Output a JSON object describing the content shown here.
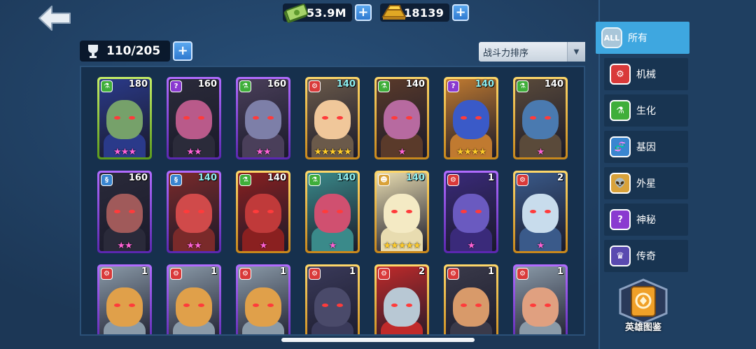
{
  "currency": {
    "cash": "53.9M",
    "gold": "18139"
  },
  "capacity": "110/205",
  "sort": {
    "label": "战斗力排序"
  },
  "cards": [
    {
      "power": "180",
      "stars": "★★★",
      "star_color": "pink",
      "frame": "green",
      "class": "bio",
      "power_color": "white",
      "skin": "#76a16a",
      "body": "#2a3a8a"
    },
    {
      "power": "160",
      "stars": "★★",
      "star_color": "pink",
      "frame": "purple",
      "class": "mystery",
      "power_color": "white",
      "skin": "#b95a8a",
      "body": "#2b2b3a"
    },
    {
      "power": "160",
      "stars": "★★",
      "star_color": "pink",
      "frame": "purple",
      "class": "bio",
      "power_color": "white",
      "skin": "#7d7fa8",
      "body": "#4a3f5a"
    },
    {
      "power": "140",
      "stars": "★★★★★",
      "star_color": "gold",
      "frame": "gold",
      "class": "mech",
      "power_color": "cyan",
      "skin": "#f0c79a",
      "body": "#6b5a4a"
    },
    {
      "power": "140",
      "stars": "★",
      "star_color": "pink",
      "frame": "gold",
      "class": "bio",
      "power_color": "white",
      "skin": "#b76aa0",
      "body": "#5a3a2a"
    },
    {
      "power": "140",
      "stars": "★★★★",
      "star_color": "gold",
      "frame": "gold",
      "class": "mystery",
      "power_color": "cyan",
      "skin": "#3a5ac8",
      "body": "#c07a30"
    },
    {
      "power": "140",
      "stars": "★",
      "star_color": "pink",
      "frame": "gold",
      "class": "bio",
      "power_color": "white",
      "skin": "#4a7ab0",
      "body": "#5a4a3a"
    },
    {
      "power": "160",
      "stars": "★★",
      "star_color": "pink",
      "frame": "purple",
      "class": "gene",
      "power_color": "white",
      "skin": "#a05a5a",
      "body": "#2a2a3a"
    },
    {
      "power": "140",
      "stars": "★★",
      "star_color": "pink",
      "frame": "purple",
      "class": "gene",
      "power_color": "cyan",
      "skin": "#d04a4a",
      "body": "#7a2a2a"
    },
    {
      "power": "140",
      "stars": "★",
      "star_color": "pink",
      "frame": "gold",
      "class": "bio",
      "power_color": "white",
      "skin": "#c03a3a",
      "body": "#8a2020"
    },
    {
      "power": "140",
      "stars": "★",
      "star_color": "pink",
      "frame": "gold",
      "class": "bio",
      "power_color": "cyan",
      "skin": "#d05070",
      "body": "#3a8a8a"
    },
    {
      "power": "140",
      "stars": "★★★★★",
      "star_color": "gold",
      "frame": "gold",
      "class": "alien",
      "power_color": "cyan",
      "skin": "#f4eac4",
      "body": "#e8dcb0"
    },
    {
      "power": "1",
      "stars": "★",
      "star_color": "pink",
      "frame": "purple",
      "class": "mech",
      "power_color": "white",
      "skin": "#6a5ac0",
      "body": "#3a2a7a"
    },
    {
      "power": "2",
      "stars": "★",
      "star_color": "pink",
      "frame": "gold",
      "class": "mech",
      "power_color": "white",
      "skin": "#c8dcec",
      "body": "#3a5a8a"
    },
    {
      "power": "1",
      "stars": "",
      "star_color": "pink",
      "frame": "purple",
      "class": "mech",
      "power_color": "white",
      "skin": "#e0a04a",
      "body": "#8a9aa8"
    },
    {
      "power": "1",
      "stars": "",
      "star_color": "pink",
      "frame": "purple",
      "class": "mech",
      "power_color": "white",
      "skin": "#e0a04a",
      "body": "#8a9aa8"
    },
    {
      "power": "1",
      "stars": "",
      "star_color": "pink",
      "frame": "purple",
      "class": "mech",
      "power_color": "white",
      "skin": "#e0a04a",
      "body": "#8a9aa8"
    },
    {
      "power": "1",
      "stars": "",
      "star_color": "pink",
      "frame": "gold",
      "class": "mech",
      "power_color": "white",
      "skin": "#4a4a6a",
      "body": "#3a3a5a"
    },
    {
      "power": "2",
      "stars": "",
      "star_color": "pink",
      "frame": "gold",
      "class": "mech",
      "power_color": "white",
      "skin": "#b8c8d4",
      "body": "#c02a2a"
    },
    {
      "power": "1",
      "stars": "",
      "star_color": "pink",
      "frame": "gold",
      "class": "mech",
      "power_color": "white",
      "skin": "#d89a6a",
      "body": "#3a3a4a"
    },
    {
      "power": "1",
      "stars": "",
      "star_color": "pink",
      "frame": "purple",
      "class": "mech",
      "power_color": "white",
      "skin": "#e0a080",
      "body": "#8a9aa8"
    }
  ],
  "filters": [
    {
      "label": "所有",
      "icon": "ALL",
      "icon_name": "all-icon",
      "color": "#a9c6d9",
      "active": true
    },
    {
      "label": "机械",
      "icon": "⚙",
      "icon_name": "mech-icon",
      "color": "#d93a3a",
      "active": false
    },
    {
      "label": "生化",
      "icon": "⚗",
      "icon_name": "flask-icon",
      "color": "#3fae3a",
      "active": false
    },
    {
      "label": "基因",
      "icon": "🧬",
      "icon_name": "dna-icon",
      "color": "#3a86d0",
      "active": false
    },
    {
      "label": "外星",
      "icon": "👽",
      "icon_name": "alien-icon",
      "color": "#d9a23a",
      "active": false
    },
    {
      "label": "神秘",
      "icon": "?",
      "icon_name": "mystery-icon",
      "color": "#8a3ad0",
      "active": false
    },
    {
      "label": "传奇",
      "icon": "♛",
      "icon_name": "legend-icon",
      "color": "#5a4ab0",
      "active": false
    }
  ],
  "codex": {
    "label": "英雄图鉴"
  },
  "colors": {
    "class_mech": "#d93a3a",
    "class_bio": "#3fae3a",
    "class_gene": "#3a86d0",
    "class_alien": "#d9a23a",
    "class_mystery": "#8a3ad0"
  }
}
